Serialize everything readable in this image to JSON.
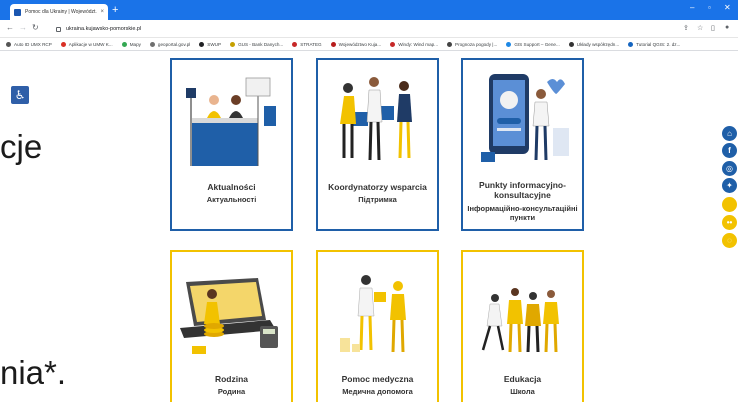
{
  "browser": {
    "tab_title": "Pomoc dla Ukrainy | Województ...",
    "tab_close": "×",
    "new_tab": "+",
    "url": "ukraina.kujawsko-pomorskie.pl",
    "bookmarks": [
      {
        "label": "Auto ID UMX RCP",
        "color": "#555555"
      },
      {
        "label": "Aplikacje w UMW K...",
        "color": "#d93025"
      },
      {
        "label": "Mapy",
        "color": "#34a853"
      },
      {
        "label": "geoportal.gov.pl",
        "color": "#6f6f6f"
      },
      {
        "label": "SWUP",
        "color": "#202124"
      },
      {
        "label": "GUS - Bank Danych...",
        "color": "#c5a000"
      },
      {
        "label": "STRATEG",
        "color": "#c62828"
      },
      {
        "label": "Województwo Kuja...",
        "color": "#b71c1c"
      },
      {
        "label": "Windy: Wind map...",
        "color": "#c62828"
      },
      {
        "label": "Prognoza pogody |...",
        "color": "#444444"
      },
      {
        "label": "GIS Support – Gene...",
        "color": "#1e88e5"
      },
      {
        "label": "Układy współrzędn...",
        "color": "#333333"
      },
      {
        "label": "Tutorial QGIS: 2. dz...",
        "color": "#1565c0"
      }
    ]
  },
  "page": {
    "left_text_1": "cje",
    "left_text_2": "nia*.",
    "cards": [
      {
        "title": "Aktualności",
        "subtitle": "Актуальності",
        "style": "blue",
        "art": "news"
      },
      {
        "title": "Koordynatorzy wsparcia",
        "subtitle": "Підтримка",
        "style": "blue",
        "art": "coordinators"
      },
      {
        "title": "Punkty informacyjno-konsultacyjne",
        "subtitle": "Інформаційно-консультаційні пункти",
        "style": "blue",
        "art": "info-points"
      },
      {
        "title": "Rodzina",
        "subtitle": "Родина",
        "style": "yellow",
        "art": "family"
      },
      {
        "title": "Pomoc medyczna",
        "subtitle": "Медична допомога",
        "style": "yellow",
        "art": "medical"
      },
      {
        "title": "Edukacja",
        "subtitle": "Школа",
        "style": "yellow",
        "art": "education"
      }
    ],
    "social": [
      {
        "icon": "home-icon",
        "color": "#1f5fa8",
        "glyph": "⌂"
      },
      {
        "icon": "facebook-icon",
        "color": "#1f5fa8",
        "glyph": "f"
      },
      {
        "icon": "instagram-icon",
        "color": "#1f5fa8",
        "glyph": "◎"
      },
      {
        "icon": "twitter-icon",
        "color": "#1f5fa8",
        "glyph": "✦"
      },
      {
        "icon": "circle-yellow-icon",
        "color": "#f2c200",
        "glyph": ""
      },
      {
        "icon": "flickr-icon",
        "color": "#f2c200",
        "glyph": "••"
      },
      {
        "icon": "map-icon",
        "color": "#f2c200",
        "glyph": "◌"
      }
    ]
  },
  "colors": {
    "blue": "#1f5fa8",
    "yellow": "#f2c200",
    "chrome_blue": "#1a73e8"
  }
}
